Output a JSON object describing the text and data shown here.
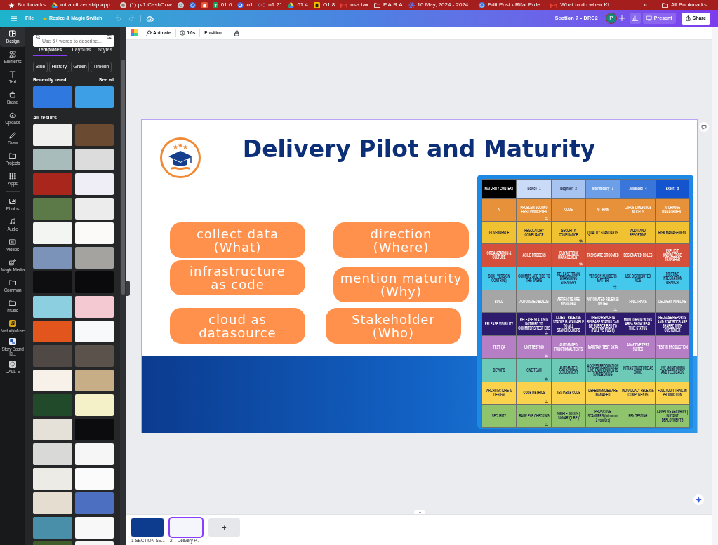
{
  "bookmarks_bar": {
    "items": [
      {
        "kind": "labeled",
        "label": "Bookmarks"
      },
      {
        "kind": "labeled",
        "label": "mira citizenship app..."
      },
      {
        "kind": "labeled",
        "label": "(1) p-1 CashCow"
      },
      {
        "kind": "icon_only"
      },
      {
        "kind": "icon_only"
      },
      {
        "kind": "icon_only"
      },
      {
        "kind": "labeled",
        "label": "01.6"
      },
      {
        "kind": "labeled",
        "label": "o1"
      },
      {
        "kind": "labeled",
        "label": "o1.21"
      },
      {
        "kind": "labeled",
        "label": "01.4"
      },
      {
        "kind": "labeled",
        "label": "O1.8"
      },
      {
        "kind": "labeled",
        "label": "usa tax"
      },
      {
        "kind": "labeled",
        "label": "P.A.R.A"
      },
      {
        "kind": "labeled",
        "label": "10 May, 2024 - 2024..."
      },
      {
        "kind": "labeled",
        "label": "Edit Post ‹ Rifat Erde..."
      },
      {
        "kind": "labeled",
        "label": "What to do when Ki..."
      }
    ],
    "more": "»",
    "all_bookmarks": "All Bookmarks"
  },
  "editor_header": {
    "file": "File",
    "resize": "Resize & Magic Switch",
    "undo": {
      "disabled": true
    },
    "redo": {
      "disabled": true
    },
    "document_title": "Section 7 - DRC2",
    "avatar_initial": "P",
    "present": "Present",
    "share": "Share"
  },
  "side_rail": {
    "items": [
      {
        "label": "Design",
        "selected": true
      },
      {
        "label": "Elements",
        "selected": false
      },
      {
        "label": "Text",
        "selected": false
      },
      {
        "label": "Brand",
        "selected": false
      },
      {
        "label": "Uploads",
        "selected": false
      },
      {
        "label": "Draw",
        "selected": false
      },
      {
        "label": "Projects",
        "selected": false
      },
      {
        "label": "Apps",
        "selected": false
      }
    ],
    "apps": [
      {
        "label": "Photos",
        "selected": false
      },
      {
        "label": "Audio",
        "selected": false
      },
      {
        "label": "Videos",
        "selected": false
      },
      {
        "label": "Magic Media",
        "selected": false
      },
      {
        "label": "Common",
        "selected": false
      },
      {
        "label": "music",
        "selected": false
      },
      {
        "label": "MelodyMuse",
        "selected": false
      },
      {
        "label": "Story Board Ki...",
        "selected": false
      },
      {
        "label": "DALL-E",
        "selected": false
      }
    ]
  },
  "templates_panel": {
    "search": {
      "placeholder": "Use 5+ words to describe..."
    },
    "tabs": [
      {
        "label": "Templates",
        "selected": true
      },
      {
        "label": "Layouts",
        "selected": false
      },
      {
        "label": "Styles",
        "selected": false
      }
    ],
    "filters": [
      "Blue",
      "History",
      "Green",
      "Timelin"
    ],
    "recently_used": {
      "heading": "Recently used",
      "see_all": "See all",
      "thumbnails": [
        {
          "color": "#2f78e0"
        },
        {
          "color": "#3d9fe6"
        }
      ]
    },
    "all_results": {
      "heading": "All results",
      "thumbnails": [
        {
          "color": "#f0f0ee"
        },
        {
          "color": "#6a4a30"
        },
        {
          "color": "#a9bcbc"
        },
        {
          "color": "#dcdcdc"
        },
        {
          "color": "#a8261c"
        },
        {
          "color": "#efedf6"
        },
        {
          "color": "#5c7a48"
        },
        {
          "color": "#ececec"
        },
        {
          "color": "#f3f5f2"
        },
        {
          "color": "#fbfaf8"
        },
        {
          "color": "#7b93b8"
        },
        {
          "color": "#a5a3a0"
        },
        {
          "color": "#0e0e10"
        },
        {
          "color": "#0a0a0c"
        },
        {
          "color": "#8ccfe0"
        },
        {
          "color": "#f4c9d2"
        },
        {
          "color": "#e2561e"
        },
        {
          "color": "#f7f9fb"
        },
        {
          "color": "#4f4844"
        },
        {
          "color": "#5a524b"
        },
        {
          "color": "#f7f1ea"
        },
        {
          "color": "#c7ae86"
        },
        {
          "color": "#214a2b"
        },
        {
          "color": "#f4f1c9"
        },
        {
          "color": "#e6e1d8"
        },
        {
          "color": "#0c0c0e"
        },
        {
          "color": "#d9d9d7"
        },
        {
          "color": "#f6f6f6"
        },
        {
          "color": "#ecebe5"
        },
        {
          "color": "#fbfbfb"
        },
        {
          "color": "#e5ddd0"
        },
        {
          "color": "#4d6fc2"
        },
        {
          "color": "#4a8faa"
        },
        {
          "color": "#f8f8f8"
        },
        {
          "color": "#3f5e2c"
        },
        {
          "color": "#f6f6f4"
        }
      ]
    }
  },
  "toolbar": {
    "animate": "Animate",
    "duration": "5.0s",
    "position": "Position"
  },
  "slide": {
    "title": "Delivery Pilot and Maturity",
    "pills": [
      "collect data (What)",
      "direction (Where)",
      "infrastructure as code",
      "mention maturity (Why)",
      "cloud as datasource",
      "Stakeholder (Who)"
    ],
    "maturity_table": {
      "corner": "MATURITY CONTEXT",
      "columns": [
        {
          "label": "Novice - 1",
          "color": "#c9dbf6"
        },
        {
          "label": "Beginner - 2",
          "color": "#a7c4f1"
        },
        {
          "label": "Intermediary - 3",
          "color": "#6d9fe9"
        },
        {
          "label": "Advanced - 4",
          "color": "#3a76da"
        },
        {
          "label": "Expert - 5",
          "color": "#1454cf"
        }
      ],
      "rows": [
        {
          "label": "AI",
          "color": "#e8913b",
          "cells": [
            {
              "text": "PROBLEM SOLVING FIRST PRINCIPLES",
              "linked": true
            },
            {
              "text": "CODE",
              "linked": false
            },
            {
              "text": "AI TRAIN",
              "linked": false
            },
            {
              "text": "LARGE LANGUAGE MODELS",
              "linked": false
            },
            {
              "text": "AI CHANGE MANAGEMENT",
              "linked": false
            }
          ]
        },
        {
          "label": "GOVERNENCE",
          "color": "#f0c232",
          "cells": [
            {
              "text": "REGULATORY COMPLIANCE",
              "linked": false
            },
            {
              "text": "SECURITY COMPLIANCE",
              "linked": true
            },
            {
              "text": "QUALITY STANDARTS",
              "linked": false
            },
            {
              "text": "AUDIT AND REPORTING",
              "linked": false
            },
            {
              "text": "RISK MANAGEMENT",
              "linked": false
            }
          ]
        },
        {
          "label": "ORGANIZATION & CULTURE",
          "color": "#d5503b",
          "cells": [
            {
              "text": "AGILE PROCESS",
              "linked": false
            },
            {
              "text": "BUYIN FROM MANAGEMENT",
              "linked": true
            },
            {
              "text": "TASKS ARE GROOMED",
              "linked": false
            },
            {
              "text": "DESIGNATED ROLES",
              "linked": false
            },
            {
              "text": "EXPLICIT KNOWLEDGE TRANSFER",
              "linked": false
            }
          ]
        },
        {
          "label": "SCM ( VERSION CONTROL)",
          "color": "#44c8ec",
          "cells": [
            {
              "text": "COMMITS ARE TIED TO THE TASKS",
              "linked": false
            },
            {
              "text": "RELEASE TRAIN BRANCHING STRATEGY",
              "linked": false
            },
            {
              "text": "VERSION NUMBERS MATTER",
              "linked": true
            },
            {
              "text": "USE DISTRIBUTED VCS",
              "linked": false
            },
            {
              "text": "PRISTINE INTEGRATION BRANCH",
              "linked": false
            }
          ]
        },
        {
          "label": "BUILD",
          "color": "#a6a6a6",
          "cells": [
            {
              "text": "AUTOMATED BUILDS",
              "linked": false
            },
            {
              "text": "ARTIFACTS ARE MANAGED",
              "linked": false
            },
            {
              "text": "AUTOMATED RELEASE NOTES",
              "linked": true
            },
            {
              "text": "FULL TRACE",
              "linked": false
            },
            {
              "text": "DELIVERY PIPELINE",
              "linked": false
            }
          ]
        },
        {
          "label": "RELEASE VISIBILITY",
          "color": "#2e1b6d",
          "cells": [
            {
              "text": "RELEASE STATUS IS NOTIFIED TO COMMITERS,TEST ERS",
              "linked": true
            },
            {
              "text": "LATEST RELEASE STATUS IS AVAILABLE TO ALL STAKEHOLDERS",
              "linked": false
            },
            {
              "text": "TREND REPORTS RELEASE STATUS CAN BE SUBSCRIBED TO (PULL VS PUSH )",
              "linked": false
            },
            {
              "text": "MONITORS IN WORK AREA SHOW REAL TIME STATUS",
              "linked": false
            },
            {
              "text": "RELEASE REPORTS AND STATISTICS ARE SHARED WITH CUSTOMER",
              "linked": false
            }
          ]
        },
        {
          "label": "TEST QA",
          "color": "#b67fc5",
          "cells": [
            {
              "text": "UNIT TESTING",
              "linked": true
            },
            {
              "text": "AUTOMATED FUNCTIONAL TESTS",
              "linked": false
            },
            {
              "text": "MAINTAIN TEST DATA",
              "linked": false
            },
            {
              "text": "ADAPTIVE TEST SUITES",
              "linked": false
            },
            {
              "text": "TEST IN PRODUCTION",
              "linked": false
            }
          ]
        },
        {
          "label": "DEVOPS",
          "color": "#6ccab6",
          "cells": [
            {
              "text": "ONE TEAM",
              "linked": true
            },
            {
              "text": "AUTOMATED DEPLOYMENT",
              "linked": false
            },
            {
              "text": "ACCESS PRODUCTION LIKE ENVIRONMENTS SANDBOXING",
              "linked": false
            },
            {
              "text": "INFRASTRUCTURE AS CODE",
              "linked": false
            },
            {
              "text": "LIVE MONITORING AND FEEDBACK",
              "linked": false
            }
          ]
        },
        {
          "label": "ARCHITECTURE & DESIGN",
          "color": "#fbd24b",
          "cells": [
            {
              "text": "CODE METRICS",
              "linked": true
            },
            {
              "text": "TESTABLE CODE",
              "linked": false
            },
            {
              "text": "DEPENDENCIES ARE MANAGED",
              "linked": false
            },
            {
              "text": "INDIVIDUALY RELEASE COMPONENTS",
              "linked": false
            },
            {
              "text": "FULL AUDIT TRAIL IN PRODUCTION",
              "linked": false
            }
          ]
        },
        {
          "label": "SECURITY",
          "color": "#8fc46c",
          "cells": [
            {
              "text": "BARE EYE CHECKING",
              "linked": true
            },
            {
              "text": "SIMPLE TOOLS ( SONAR QUBE )",
              "linked": false
            },
            {
              "text": "PROACTIVE SCANNERS (minimum 2 vendors)",
              "linked": false
            },
            {
              "text": "PEN TESTING",
              "linked": false
            },
            {
              "text": "ADAPTIVE SECURITY ( INSTANT DEPLOYMENTS",
              "linked": false
            }
          ]
        }
      ]
    }
  },
  "pages": [
    {
      "label": "1-SECTION SE...",
      "color": "#0d3b8e",
      "selected": false
    },
    {
      "label": "2-T-Delivery P...",
      "color": "#f4f6fb",
      "selected": true
    }
  ],
  "add_page": "+"
}
